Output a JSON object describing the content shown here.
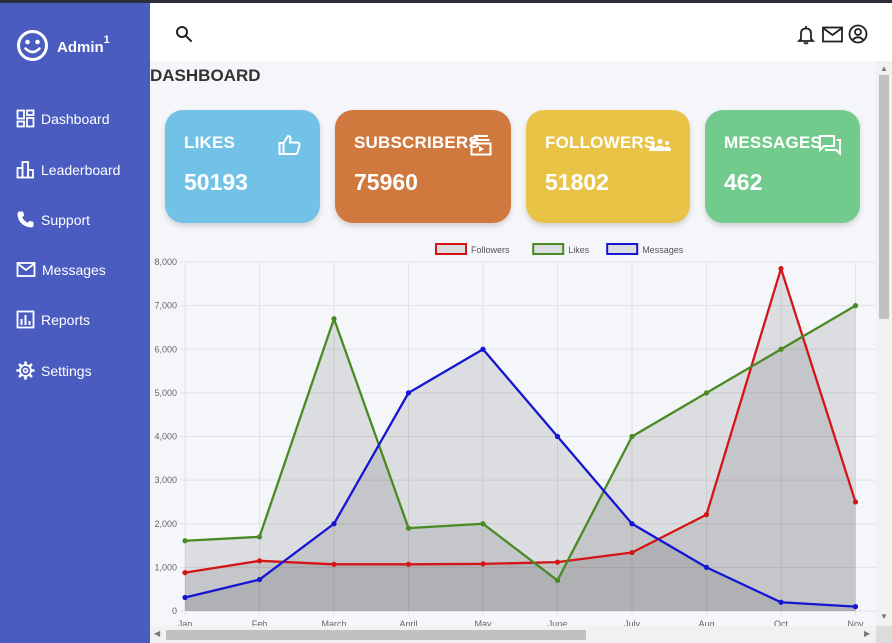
{
  "brand": {
    "name": "Admin",
    "sup": "1"
  },
  "nav": [
    {
      "label": "Dashboard",
      "icon": "dashboard-icon"
    },
    {
      "label": "Leaderboard",
      "icon": "leaderboard-icon"
    },
    {
      "label": "Support",
      "icon": "phone-icon"
    },
    {
      "label": "Messages",
      "icon": "mail-icon"
    },
    {
      "label": "Reports",
      "icon": "report-icon"
    },
    {
      "label": "Settings",
      "icon": "gear-icon"
    }
  ],
  "page_title": "DASHBOARD",
  "cards": [
    {
      "title": "LIKES",
      "value": "50193",
      "color": "#72c2e7",
      "icon": "thumbs-up-icon"
    },
    {
      "title": "SUBSCRIBERS",
      "value": "75960",
      "color": "#d0793e",
      "icon": "subscriptions-icon"
    },
    {
      "title": "FOLLOWERS",
      "value": "51802",
      "color": "#e8c346",
      "icon": "group-icon"
    },
    {
      "title": "MESSAGES",
      "value": "462",
      "color": "#72cb8d",
      "icon": "chat-icon"
    }
  ],
  "colors": {
    "sidebar": "#4a5cc0",
    "content_bg": "#f5f6fa"
  },
  "chart_data": {
    "type": "area",
    "categories": [
      "Jan",
      "Feb",
      "March",
      "April",
      "May",
      "June",
      "July",
      "Aug",
      "Oct",
      "Nov"
    ],
    "series": [
      {
        "name": "Followers",
        "color": "#d41515",
        "values": [
          880,
          1150,
          1070,
          1070,
          1080,
          1120,
          1340,
          2210,
          7850,
          2500
        ]
      },
      {
        "name": "Likes",
        "color": "#4a8a25",
        "values": [
          1610,
          1700,
          6700,
          1900,
          2000,
          700,
          4000,
          5000,
          6000,
          7000
        ]
      },
      {
        "name": "Messages",
        "color": "#1515d4",
        "values": [
          310,
          720,
          2000,
          5000,
          6000,
          4000,
          2000,
          1000,
          200,
          100
        ]
      }
    ],
    "ylim": [
      0,
      8000
    ],
    "yticks": [
      "0",
      "1,000",
      "2,000",
      "3,000",
      "4,000",
      "5,000",
      "6,000",
      "7,000",
      "8,000"
    ],
    "legend": "top-center",
    "grid": true
  }
}
